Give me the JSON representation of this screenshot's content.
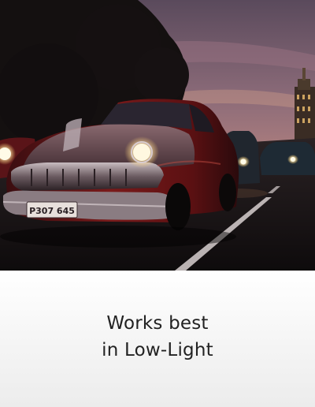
{
  "caption": {
    "line1": "Works best",
    "line2": "in Low-Light"
  },
  "hero_image": {
    "plate_text": "P307 645"
  },
  "colors": {
    "sky_top": "#5e4a5a",
    "sky_bottom": "#c98a7e",
    "car_red": "#6e1414",
    "headlight": "#fff6d8",
    "caption_bg": "#f2f2f2",
    "caption_text": "#222222"
  }
}
